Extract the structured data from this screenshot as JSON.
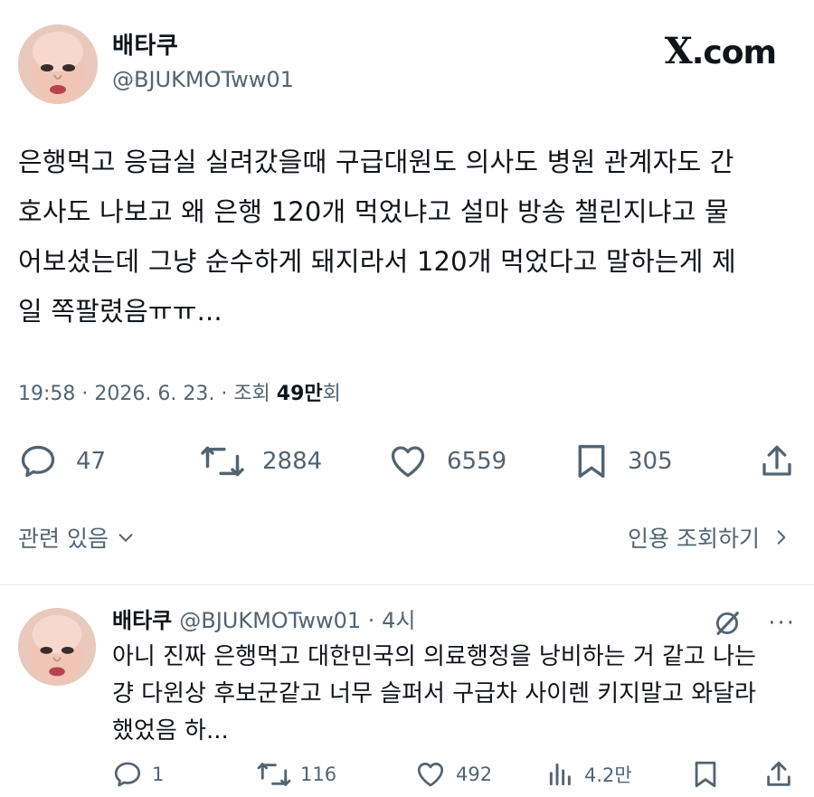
{
  "tweet": {
    "display_name": "배타쿠",
    "handle": "@BJUKMOTww01",
    "brand": "X.com",
    "brand_rest": ".com",
    "brand_mark": "X",
    "body_lines": [
      "은행먹고 응급실 실려갔을때 구급대원도 의사도 병원 관계자도 간",
      "호사도 나보고 왜 은행 120개 먹었냐고 설마 방송 챌린지냐고 물",
      "어보셨는데 그냥 순수하게 돼지라서 120개 먹었다고 말하는게 제",
      "일 쪽팔렸음ㅠㅠ..."
    ],
    "meta_prefix": "19:58 · 2026. 6. 23. · 조회 ",
    "views_bold": "49만",
    "views_suffix": "회",
    "stats": {
      "replies": "47",
      "retweets": "2884",
      "likes": "6559",
      "bookmarks": "305"
    },
    "related_label": "관련 있음",
    "quotes_label": "인용 조회하기"
  },
  "reply": {
    "display_name": "배타쿠",
    "meta": "@BJUKMOTww01 · 4시",
    "more": "···",
    "text_lines": [
      "아니 진짜 은행먹고 대한민국의 의료행정을 낭비하는 거 같고 나는",
      "걍 다윈상 후보군같고 너무 슬퍼서 구급차 사이렌 키지말고 와달라",
      "했었음 하..."
    ],
    "stats": {
      "replies": "1",
      "retweets": "116",
      "likes": "492",
      "views": "4.2만"
    }
  },
  "colors": {
    "text": "#0f1419",
    "secondary": "#536471",
    "divider": "#e6e9eb"
  },
  "icons": [
    "reply-icon",
    "retweet-icon",
    "heart-icon",
    "bookmark-icon",
    "share-icon",
    "chevron-down-icon",
    "chevron-right-icon",
    "grok-icon",
    "views-icon",
    "more-icon"
  ]
}
